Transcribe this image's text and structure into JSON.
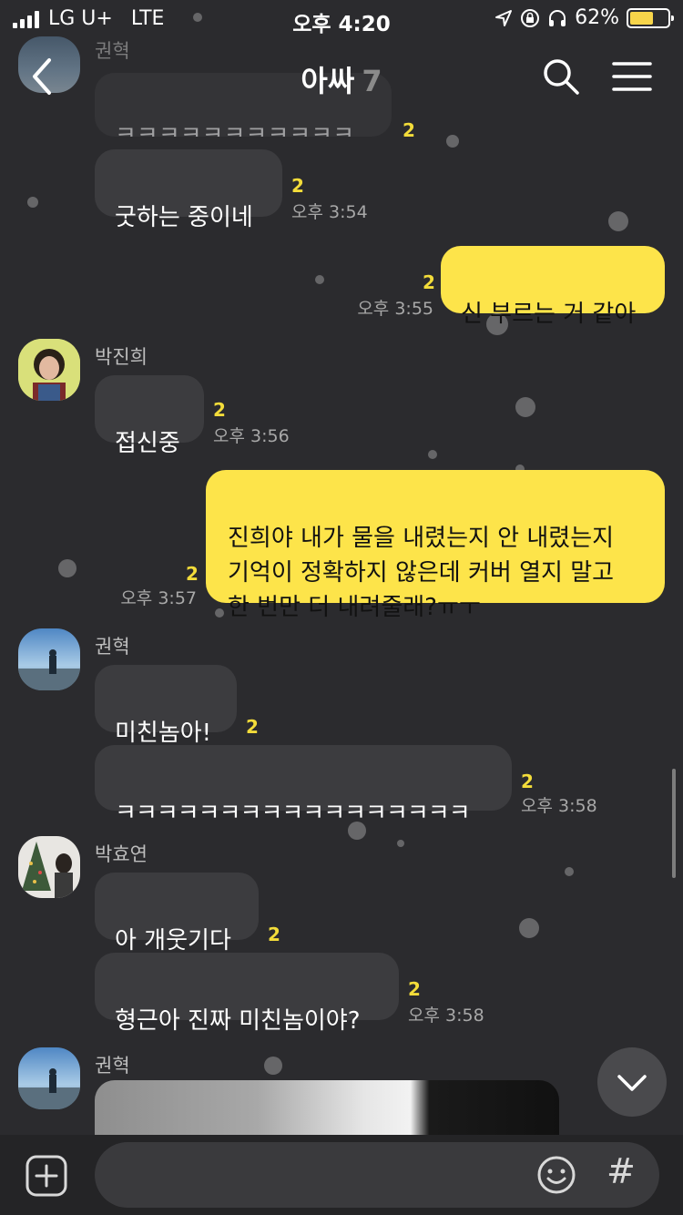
{
  "status_bar": {
    "carrier": "LG U+",
    "network": "LTE",
    "time": "오후 4:20",
    "battery": "62%",
    "battery_level": 0.62
  },
  "header": {
    "title": "아싸",
    "member_count": "7"
  },
  "top_partial": {
    "text": "ㅋㅋㅋㅋㅋㅋㅋㅋㅋㅋㅋㅋ",
    "timestamp": "오후 3:54",
    "unread": "2",
    "sender": "권혁"
  },
  "messages": [
    {
      "sender": "",
      "text": "굿하는 중이네",
      "unread": "2",
      "time": "오후 3:54"
    },
    {
      "sender": "me",
      "text": "신 부르는 거 같아",
      "unread": "2",
      "time": "오후 3:55"
    },
    {
      "sender": "박진희",
      "text": "접신중",
      "unread": "2",
      "time": "오후 3:56"
    },
    {
      "sender": "me",
      "text": "진희야 내가 물을 내렸는지 안 내렸는지\n기억이 정확하지 않은데 커버 열지 말고\n한 번만 더 내려줄래?ㅠㅜ",
      "unread": "2",
      "time": "오후 3:57"
    },
    {
      "sender": "권혁",
      "text": "미친놈아!",
      "unread": "2",
      "time": ""
    },
    {
      "sender": "",
      "text": "ㅋㅋㅋㅋㅋㅋㅋㅋㅋㅋㅋㅋㅋㅋㅋㅋㅋ",
      "unread": "2",
      "time": "오후 3:58"
    },
    {
      "sender": "박효연",
      "text": "아 개웃기다",
      "unread": "2",
      "time": ""
    },
    {
      "sender": "",
      "text": "형근아 진짜 미친놈이야?",
      "unread": "2",
      "time": "오후 3:58"
    },
    {
      "sender": "권혁",
      "text": "",
      "unread": "",
      "time": ""
    }
  ],
  "icons": {
    "back": "chevron-left-icon",
    "search": "search-icon",
    "menu": "hamburger-menu-icon",
    "scroll_down": "chevron-down-icon",
    "attach": "plus-icon",
    "emoji": "emoji-icon",
    "hash": "#"
  },
  "colors": {
    "background": "#2b2b2e",
    "my_bubble": "#fde44a",
    "other_bubble": "#3c3c3f",
    "unread_count": "#f3dc3a"
  }
}
